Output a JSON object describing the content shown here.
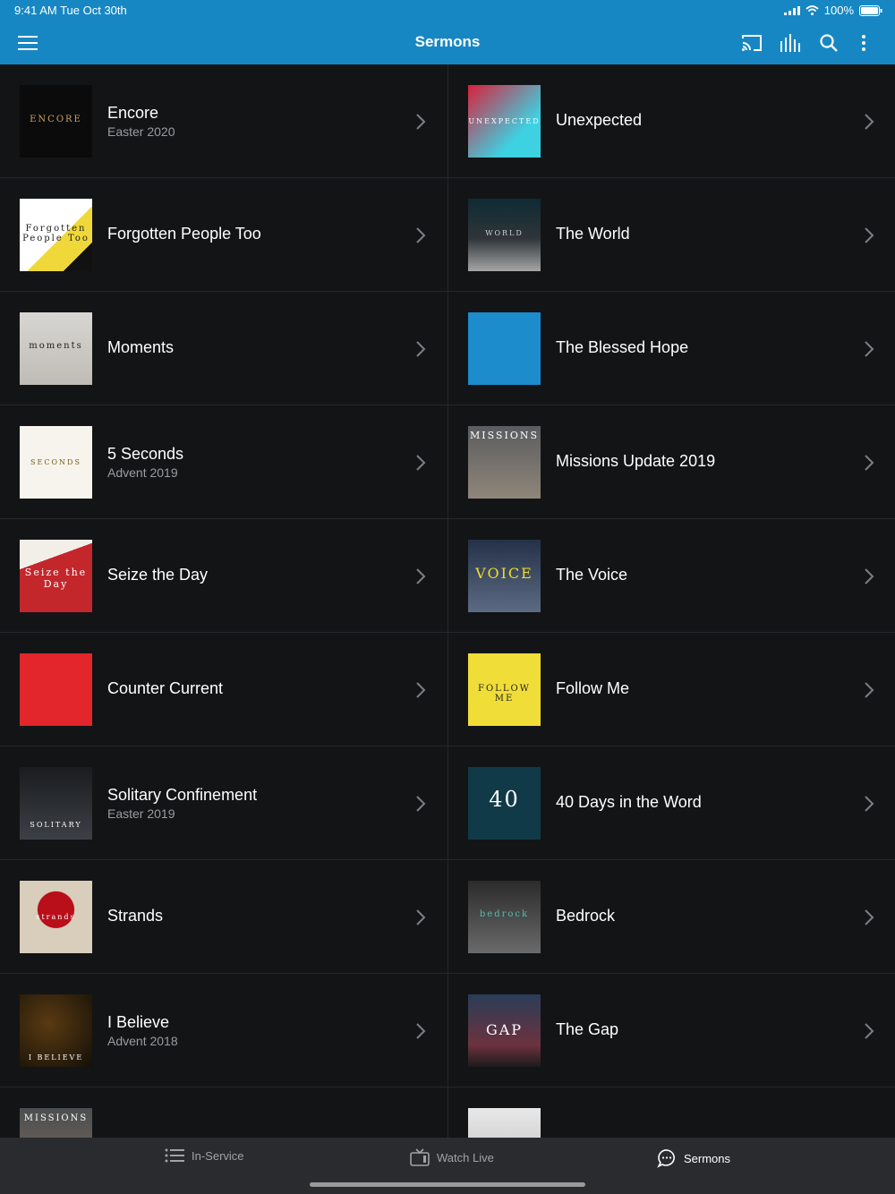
{
  "status": {
    "time": "9:41 AM   Tue Oct 30th",
    "battery": "100%"
  },
  "header": {
    "title": "Sermons"
  },
  "sermons_left": [
    {
      "title": "Encore",
      "subtitle": "Easter 2020",
      "art_text": "ENCORE"
    },
    {
      "title": "Forgotten People Too",
      "subtitle": "",
      "art_text": "Forgotten People Too"
    },
    {
      "title": "Moments",
      "subtitle": "",
      "art_text": "moments"
    },
    {
      "title": "5 Seconds",
      "subtitle": "Advent 2019",
      "art_text": "SECONDS"
    },
    {
      "title": "Seize the Day",
      "subtitle": "",
      "art_text": "Seize the Day"
    },
    {
      "title": "Counter Current",
      "subtitle": "",
      "art_text": ""
    },
    {
      "title": "Solitary Confinement",
      "subtitle": "Easter 2019",
      "art_text": "SOLITARY"
    },
    {
      "title": "Strands",
      "subtitle": "",
      "art_text": "strands"
    },
    {
      "title": "I Believe",
      "subtitle": "Advent 2018",
      "art_text": "I BELIEVE"
    },
    {
      "title": "",
      "subtitle": "",
      "art_text": "MISSIONS"
    }
  ],
  "sermons_right": [
    {
      "title": "Unexpected",
      "subtitle": "",
      "art_text": "UNEXPECTED"
    },
    {
      "title": "The World",
      "subtitle": "",
      "art_text": "WORLD"
    },
    {
      "title": "The Blessed Hope",
      "subtitle": "",
      "art_text": ""
    },
    {
      "title": "Missions Update 2019",
      "subtitle": "",
      "art_text": "MISSIONS"
    },
    {
      "title": "The Voice",
      "subtitle": "",
      "art_text": "VOICE"
    },
    {
      "title": "Follow Me",
      "subtitle": "",
      "art_text": "FOLLOW ME"
    },
    {
      "title": "40 Days in the Word",
      "subtitle": "",
      "art_text": "40"
    },
    {
      "title": "Bedrock",
      "subtitle": "",
      "art_text": "bedrock"
    },
    {
      "title": "The Gap",
      "subtitle": "",
      "art_text": "GAP"
    },
    {
      "title": "",
      "subtitle": "",
      "art_text": ""
    }
  ],
  "tabs": [
    {
      "label": "In-Service",
      "icon": "list-icon"
    },
    {
      "label": "Watch Live",
      "icon": "tv-icon"
    },
    {
      "label": "Sermons",
      "icon": "chat-bubble-icon"
    }
  ],
  "colors": {
    "accent": "#1787c4",
    "background": "#131416",
    "tabbar": "#2a2b2e"
  }
}
